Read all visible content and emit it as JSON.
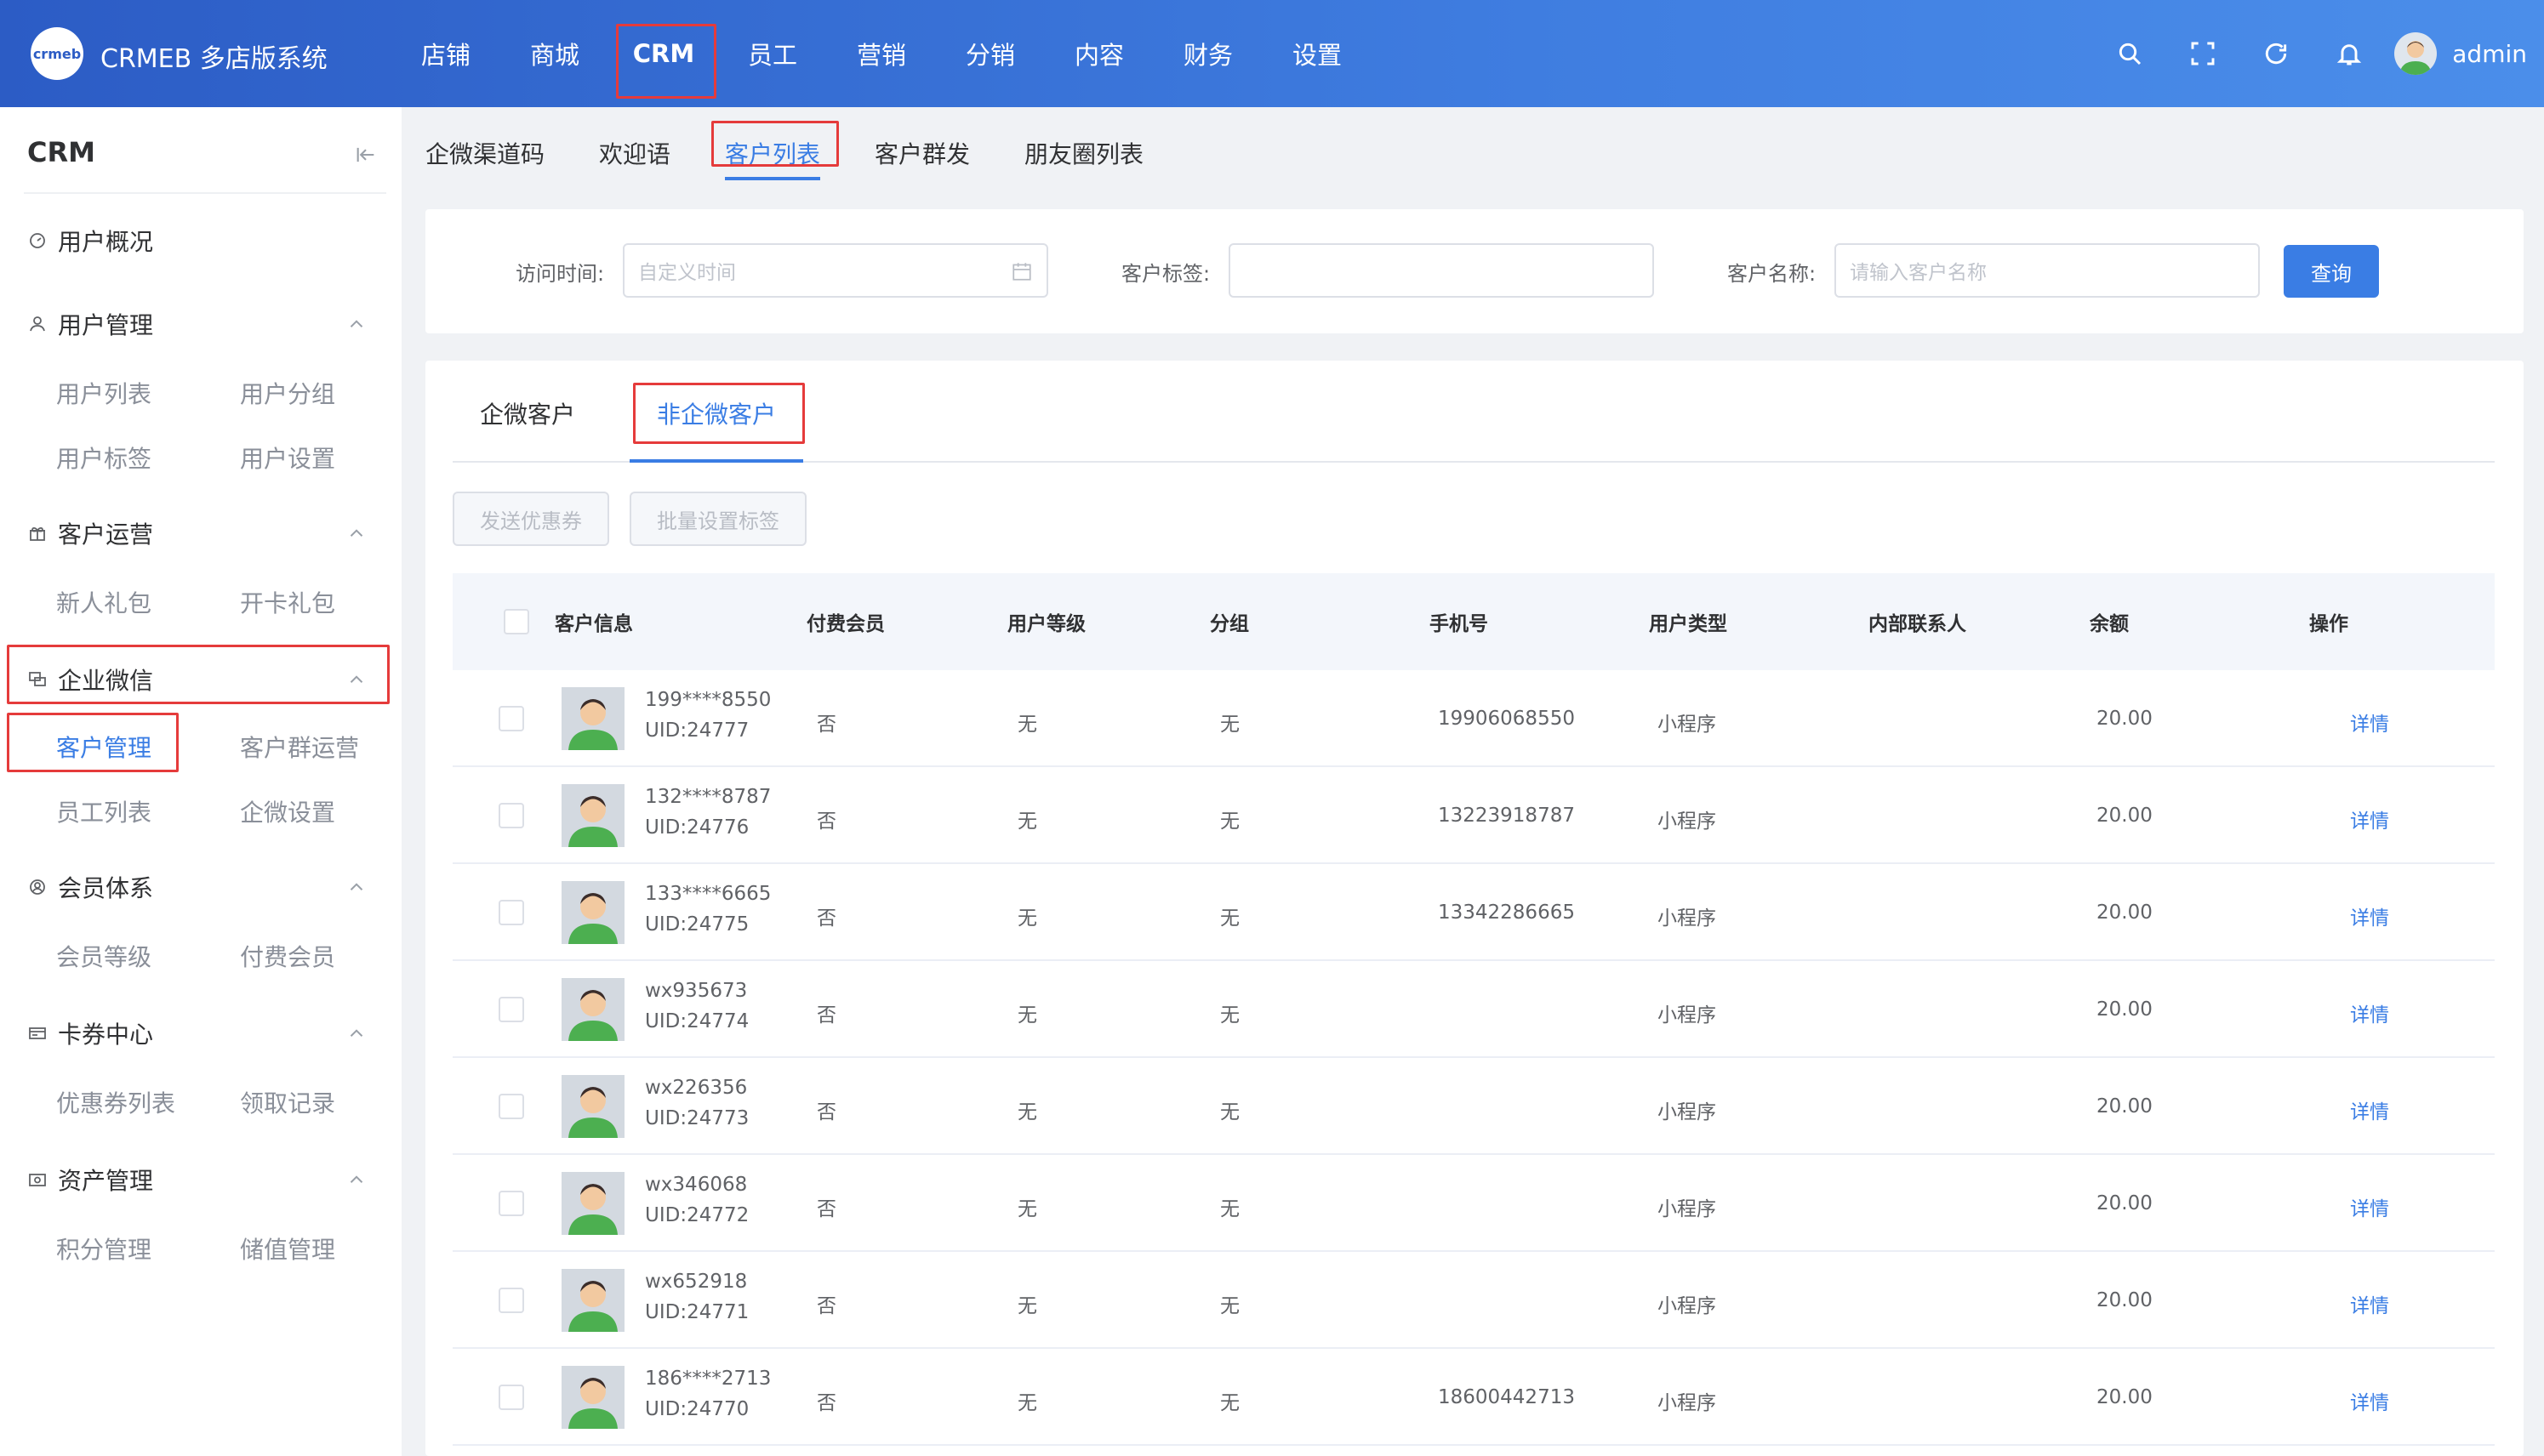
{
  "header": {
    "logo_text": "crmeb",
    "brand": "CRMEB 多店版系统",
    "nav": [
      "店铺",
      "商城",
      "CRM",
      "员工",
      "营销",
      "分销",
      "内容",
      "财务",
      "设置"
    ],
    "active_nav": "CRM",
    "admin": "admin"
  },
  "sidebar": {
    "title": "CRM",
    "groups": [
      {
        "label": "用户概况",
        "icon": "dashboard-icon",
        "subs": []
      },
      {
        "label": "用户管理",
        "icon": "user-icon",
        "subs": [
          "用户列表",
          "用户分组",
          "用户标签",
          "用户设置"
        ]
      },
      {
        "label": "客户运营",
        "icon": "gift-icon",
        "subs": [
          "新人礼包",
          "开卡礼包"
        ]
      },
      {
        "label": "企业微信",
        "icon": "chat-icon",
        "subs": [
          "客户管理",
          "客户群运营",
          "员工列表",
          "企微设置"
        ]
      },
      {
        "label": "会员体系",
        "icon": "member-icon",
        "subs": [
          "会员等级",
          "付费会员"
        ]
      },
      {
        "label": "卡券中心",
        "icon": "card-icon",
        "subs": [
          "优惠券列表",
          "领取记录"
        ]
      },
      {
        "label": "资产管理",
        "icon": "wallet-icon",
        "subs": [
          "积分管理",
          "储值管理"
        ]
      }
    ],
    "active_sub": "客户管理"
  },
  "subtabs": [
    "企微渠道码",
    "欢迎语",
    "客户列表",
    "客户群发",
    "朋友圈列表"
  ],
  "active_subtab": "客户列表",
  "filter": {
    "visit_time_label": "访问时间:",
    "visit_time_placeholder": "自定义时间",
    "tag_label": "客户标签:",
    "tag_value": "",
    "name_label": "客户名称:",
    "name_placeholder": "请输入客户名称",
    "query_button": "查询"
  },
  "customer_tabs": [
    "企微客户",
    "非企微客户"
  ],
  "active_customer_tab": "非企微客户",
  "actions": {
    "send_coupon": "发送优惠券",
    "batch_tag": "批量设置标签"
  },
  "table": {
    "headers": [
      "客户信息",
      "付费会员",
      "用户等级",
      "分组",
      "手机号",
      "用户类型",
      "内部联系人",
      "余额",
      "操作"
    ],
    "rows": [
      {
        "name": "199****8550",
        "uid": "UID:24777",
        "paid": "否",
        "level": "无",
        "group": "无",
        "phone": "19906068550",
        "type": "小程序",
        "contact": "",
        "balance": "20.00",
        "op": "详情"
      },
      {
        "name": "132****8787",
        "uid": "UID:24776",
        "paid": "否",
        "level": "无",
        "group": "无",
        "phone": "13223918787",
        "type": "小程序",
        "contact": "",
        "balance": "20.00",
        "op": "详情"
      },
      {
        "name": "133****6665",
        "uid": "UID:24775",
        "paid": "否",
        "level": "无",
        "group": "无",
        "phone": "13342286665",
        "type": "小程序",
        "contact": "",
        "balance": "20.00",
        "op": "详情"
      },
      {
        "name": "wx935673",
        "uid": "UID:24774",
        "paid": "否",
        "level": "无",
        "group": "无",
        "phone": "",
        "type": "小程序",
        "contact": "",
        "balance": "20.00",
        "op": "详情"
      },
      {
        "name": "wx226356",
        "uid": "UID:24773",
        "paid": "否",
        "level": "无",
        "group": "无",
        "phone": "",
        "type": "小程序",
        "contact": "",
        "balance": "20.00",
        "op": "详情"
      },
      {
        "name": "wx346068",
        "uid": "UID:24772",
        "paid": "否",
        "level": "无",
        "group": "无",
        "phone": "",
        "type": "小程序",
        "contact": "",
        "balance": "20.00",
        "op": "详情"
      },
      {
        "name": "wx652918",
        "uid": "UID:24771",
        "paid": "否",
        "level": "无",
        "group": "无",
        "phone": "",
        "type": "小程序",
        "contact": "",
        "balance": "20.00",
        "op": "详情"
      },
      {
        "name": "186****2713",
        "uid": "UID:24770",
        "paid": "否",
        "level": "无",
        "group": "无",
        "phone": "18600442713",
        "type": "小程序",
        "contact": "",
        "balance": "20.00",
        "op": "详情"
      }
    ]
  },
  "colors": {
    "primary": "#3a7de4",
    "highlight": "#e53b3b",
    "header_start": "#2c5cc5",
    "header_end": "#4b8eea"
  }
}
